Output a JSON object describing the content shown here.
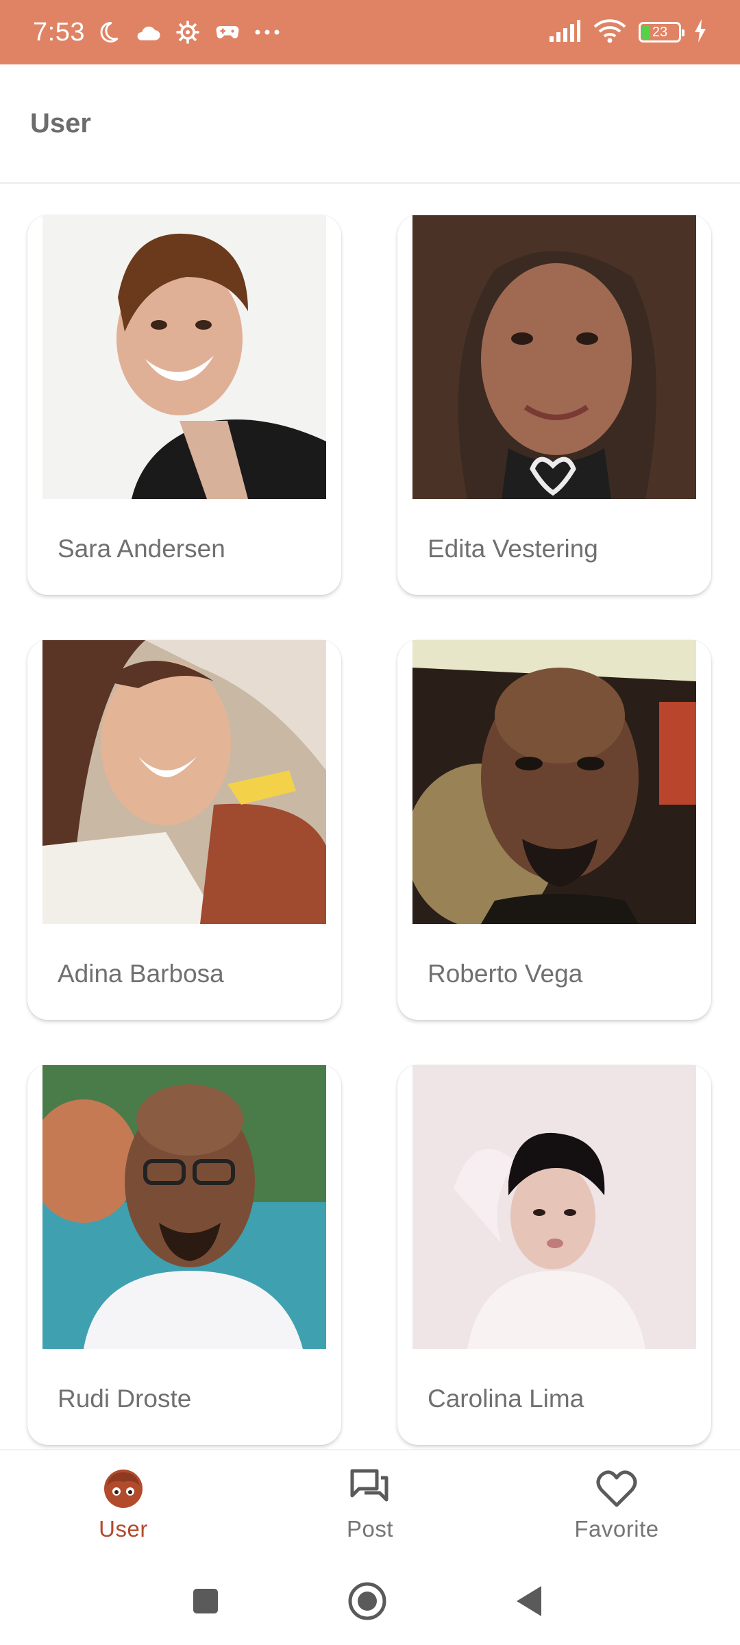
{
  "status_bar": {
    "time": "7:53",
    "battery_level": "23",
    "left_icons": [
      "moon-icon",
      "cloud-icon",
      "settings-icon",
      "gamepad-icon",
      "more-dots-icon"
    ],
    "right_icons": [
      "signal-icon",
      "wifi-icon",
      "battery-icon",
      "charging-icon"
    ],
    "background_color": "#e08364"
  },
  "app_bar": {
    "title": "User"
  },
  "users": [
    {
      "name": "Sara Andersen"
    },
    {
      "name": "Edita Vestering"
    },
    {
      "name": "Adina Barbosa"
    },
    {
      "name": "Roberto Vega"
    },
    {
      "name": "Rudi Droste"
    },
    {
      "name": "Carolina Lima"
    }
  ],
  "bottom_nav": {
    "items": [
      {
        "label": "User",
        "icon": "user-face-icon",
        "active": true
      },
      {
        "label": "Post",
        "icon": "chat-bubbles-icon",
        "active": false
      },
      {
        "label": "Favorite",
        "icon": "heart-outline-icon",
        "active": false
      }
    ],
    "active_color": "#b24a2c",
    "inactive_color": "#757575"
  },
  "system_nav": {
    "buttons": [
      "recents-square-icon",
      "home-circle-icon",
      "back-triangle-icon"
    ]
  }
}
